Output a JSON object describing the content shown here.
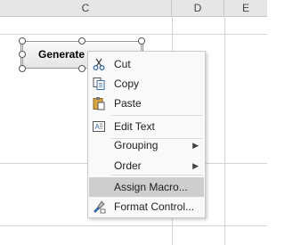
{
  "sheet": {
    "columns": [
      "C",
      "D",
      "E"
    ]
  },
  "form_control": {
    "label": "Generate"
  },
  "context_menu": {
    "items": [
      {
        "label": "Cut",
        "icon": "scissors-icon",
        "has_submenu": false
      },
      {
        "label": "Copy",
        "icon": "copy-icon",
        "has_submenu": false
      },
      {
        "label": "Paste",
        "icon": "paste-icon",
        "has_submenu": false
      },
      {
        "label": "Edit Text",
        "icon": "edit-text-icon",
        "has_submenu": false
      },
      {
        "label": "Grouping",
        "icon": "",
        "has_submenu": true
      },
      {
        "label": "Order",
        "icon": "",
        "has_submenu": true
      },
      {
        "label": "Assign Macro...",
        "icon": "",
        "has_submenu": false,
        "highlighted": true
      },
      {
        "label": "Format Control...",
        "icon": "format-control-icon",
        "has_submenu": false
      }
    ]
  },
  "colors": {
    "menu_highlight": "#cecece",
    "header_background": "#e6e6e6",
    "gridline": "#d4d4d4"
  }
}
